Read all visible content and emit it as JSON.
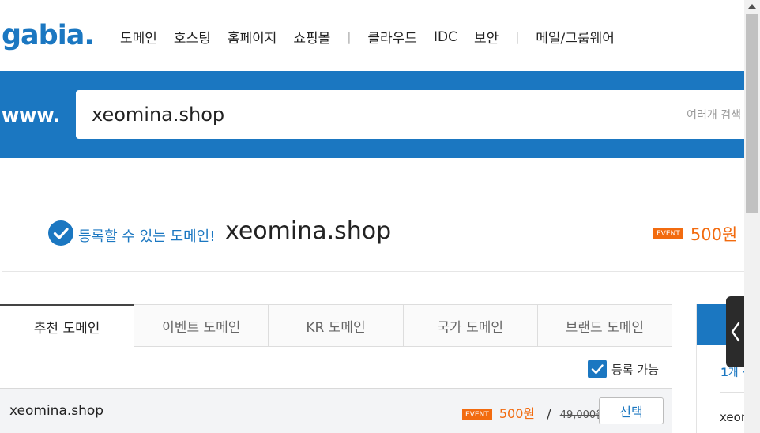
{
  "header": {
    "logo_text": "gabia.",
    "nav": [
      {
        "label": "도메인"
      },
      {
        "label": "호스팅"
      },
      {
        "label": "홈페이지"
      },
      {
        "label": "쇼핑몰"
      },
      {
        "label": "클라우드"
      },
      {
        "label": "IDC"
      },
      {
        "label": "보안"
      },
      {
        "label": "메일/그룹웨어"
      }
    ],
    "separator": "|"
  },
  "search": {
    "prefix": "www.",
    "value": "xeomina.shop",
    "multi_search_label": "여러개 검색"
  },
  "result": {
    "status_label": "등록할 수 있는 도메인!",
    "domain": "xeomina.shop",
    "badge": "EVENT",
    "price": "500원",
    "slash": "/"
  },
  "tabs": [
    {
      "label": "추천 도메인",
      "active": true
    },
    {
      "label": "이벤트 도메인",
      "active": false
    },
    {
      "label": "KR 도메인",
      "active": false
    },
    {
      "label": "국가 도메인",
      "active": false
    },
    {
      "label": "브랜드 도메인",
      "active": false
    }
  ],
  "filter": {
    "label": "등록 가능",
    "checked": true
  },
  "rows": [
    {
      "domain": "xeomina.shop",
      "badge": "EVENT",
      "price": "500원",
      "slash": "/",
      "original_price": "49,000원",
      "button": "선택"
    }
  ],
  "cart": {
    "count_number": "1",
    "count_suffix": "개 선",
    "item": "xeom"
  },
  "colors": {
    "brand_blue": "#1b77c1",
    "event_orange": "#f26b0f",
    "toggle_dark": "#2b2b2b"
  },
  "icons": {
    "check_circle": "check-circle-icon",
    "chevron_left": "chevron-left-icon",
    "checkbox": "checkbox-checked-icon"
  }
}
